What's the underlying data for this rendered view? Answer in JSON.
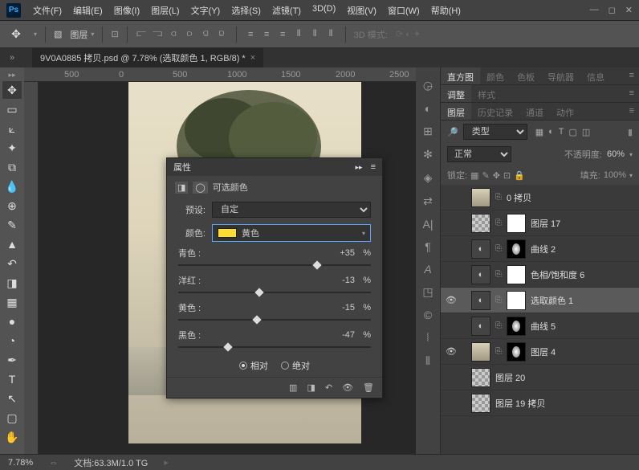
{
  "menu": [
    "文件(F)",
    "编辑(E)",
    "图像(I)",
    "图层(L)",
    "文字(Y)",
    "选择(S)",
    "滤镜(T)",
    "3D(D)",
    "视图(V)",
    "窗口(W)",
    "帮助(H)"
  ],
  "options": {
    "layer_dropdown": "图层",
    "mode3d": "3D 模式:"
  },
  "doc_tab": "9V0A0885 拷贝.psd @ 7.78% (选取颜色 1, RGB/8) *",
  "ruler_marks": [
    "500",
    "0",
    "500",
    "1000",
    "1500",
    "2000",
    "2500"
  ],
  "ruler_v_marks": [
    "5 0 0",
    "0",
    "5 0 0"
  ],
  "panels": {
    "tabs1": [
      "直方图",
      "颜色",
      "色板",
      "导航器",
      "信息"
    ],
    "tabs2": [
      "调整",
      "样式"
    ],
    "tabs3": [
      "图层",
      "历史记录",
      "通道",
      "动作"
    ]
  },
  "layers": {
    "filter_label": "类型",
    "blend_mode": "正常",
    "opacity_label": "不透明度:",
    "opacity_value": "60%",
    "lock_label": "锁定:",
    "fill_label": "填充:",
    "fill_value": "100%",
    "items": [
      {
        "name": "0 拷贝",
        "vis": false,
        "thumb": "img",
        "link": true
      },
      {
        "name": "图层 17",
        "vis": false,
        "thumbs": [
          "checker",
          "white"
        ],
        "link": true
      },
      {
        "name": "曲线 2",
        "vis": false,
        "thumbs": [
          "adj",
          "mask"
        ],
        "link": true
      },
      {
        "name": "色相/饱和度 6",
        "vis": false,
        "thumbs": [
          "adj",
          "white"
        ],
        "link": true
      },
      {
        "name": "选取颜色 1",
        "vis": true,
        "thumbs": [
          "adj",
          "white"
        ],
        "link": true,
        "selected": true
      },
      {
        "name": "曲线 5",
        "vis": false,
        "thumbs": [
          "adj",
          "mask"
        ],
        "link": true
      },
      {
        "name": "图层 4",
        "vis": true,
        "thumbs": [
          "img",
          "mask2"
        ],
        "link": true
      },
      {
        "name": "图层 20",
        "vis": false,
        "thumbs": [
          "checker"
        ],
        "link": false
      },
      {
        "name": "图层 19 拷贝",
        "vis": false,
        "thumbs": [
          "checker"
        ],
        "link": false
      }
    ]
  },
  "properties": {
    "title": "属性",
    "subtitle": "可选颜色",
    "preset_label": "预设:",
    "preset_value": "自定",
    "color_label": "颜色:",
    "color_value": "黄色",
    "sliders": [
      {
        "label": "青色 :",
        "value": "+35",
        "pos": 0.72
      },
      {
        "label": "洋红 :",
        "value": "-13",
        "pos": 0.42
      },
      {
        "label": "黄色 :",
        "value": "-15",
        "pos": 0.41
      },
      {
        "label": "黑色 :",
        "value": "-47",
        "pos": 0.26
      }
    ],
    "pct": "%",
    "relative": "相对",
    "absolute": "绝对"
  },
  "status": {
    "zoom": "7.78%",
    "doc_label": "文档:",
    "doc_value": "63.3M/1.0 TG"
  }
}
